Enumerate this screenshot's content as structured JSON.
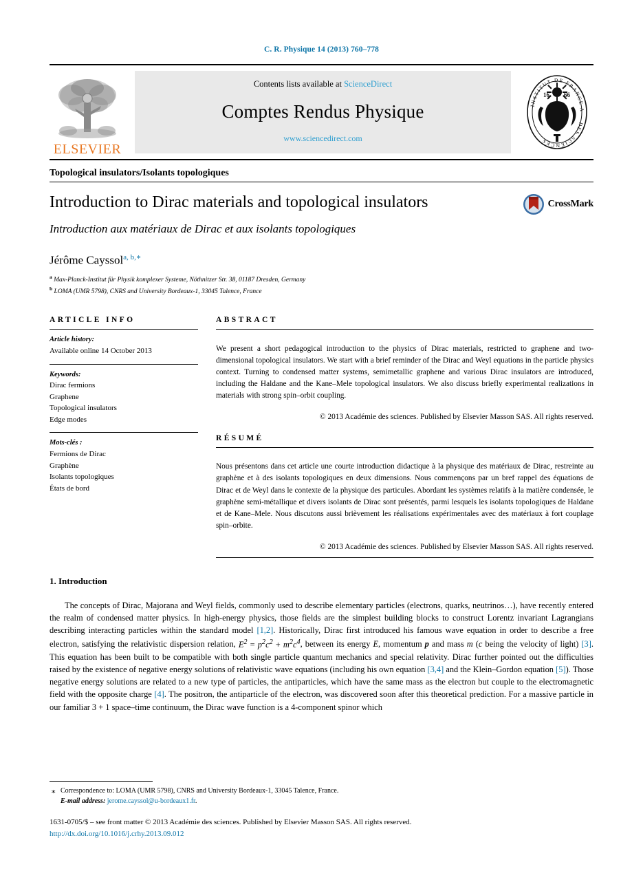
{
  "running_head": "C. R. Physique 14 (2013) 760–778",
  "masthead": {
    "contents_prefix": "Contents lists available at ",
    "contents_link": "ScienceDirect",
    "journal_title": "Comptes Rendus Physique",
    "url": "www.sciencedirect.com",
    "publisher_wordmark": "ELSEVIER",
    "seal_text": "INSTITUT DE FRANCE · ACADÉMIE DES SCIENCES 1666"
  },
  "section_label": "Topological insulators/Isolants topologiques",
  "title": {
    "main": "Introduction to Dirac materials and topological insulators",
    "french": "Introduction aux matériaux de Dirac et aux isolants topologiques",
    "crossmark_label": "CrossMark"
  },
  "authors": {
    "name": "Jérôme Cayssol",
    "marks": "a, b,",
    "star": "∗",
    "affiliations": [
      {
        "mark": "a",
        "text": "Max-Planck-Institut für Physik komplexer Systeme, Nöthnitzer Str. 38, 01187 Dresden, Germany"
      },
      {
        "mark": "b",
        "text": "LOMA (UMR 5798), CNRS and University Bordeaux-1, 33045 Talence, France"
      }
    ]
  },
  "article_info": {
    "heading": "ARTICLE INFO",
    "history_label": "Article history:",
    "history_value": "Available online 14 October 2013",
    "keywords_label": "Keywords:",
    "keywords": [
      "Dirac fermions",
      "Graphene",
      "Topological insulators",
      "Edge modes"
    ],
    "motscles_label": "Mots-clés :",
    "motscles": [
      "Fermions de Dirac",
      "Graphène",
      "Isolants topologiques",
      "États de bord"
    ]
  },
  "abstract": {
    "heading": "ABSTRACT",
    "text": "We present a short pedagogical introduction to the physics of Dirac materials, restricted to graphene and two-dimensional topological insulators. We start with a brief reminder of the Dirac and Weyl equations in the particle physics context. Turning to condensed matter systems, semimetallic graphene and various Dirac insulators are introduced, including the Haldane and the Kane–Mele topological insulators. We also discuss briefly experimental realizations in materials with strong spin–orbit coupling.",
    "copyright": "© 2013 Académie des sciences. Published by Elsevier Masson SAS. All rights reserved."
  },
  "resume": {
    "heading": "RÉSUMÉ",
    "text": "Nous présentons dans cet article une courte introduction didactique à la physique des matériaux de Dirac, restreinte au graphène et à des isolants topologiques en deux dimensions. Nous commençons par un bref rappel des équations de Dirac et de Weyl dans le contexte de la physique des particules. Abordant les systèmes relatifs à la matière condensée, le graphène semi-métallique et divers isolants de Dirac sont présentés, parmi lesquels les isolants topologiques de Haldane et de Kane–Mele. Nous discutons aussi brièvement les réalisations expérimentales avec des matériaux à fort couplage spin–orbite.",
    "copyright": "© 2013 Académie des sciences. Published by Elsevier Masson SAS. All rights reserved."
  },
  "body": {
    "section_number_title": "1. Introduction",
    "p1_a": "The concepts of Dirac, Majorana and Weyl fields, commonly used to describe elementary particles (electrons, quarks, neutrinos…), have recently entered the realm of condensed matter physics. In high-energy physics, those fields are the simplest building blocks to construct Lorentz invariant Lagrangians describing interacting particles within the standard model ",
    "ref_12": "[1,2]",
    "p1_b": ". Historically, Dirac first introduced his famous wave equation in order to describe a free electron, satisfying the relativistic dispersion relation, ",
    "equation": "E² = p²c² + m²c⁴",
    "p1_c": ", between its energy ",
    "sym_E": "E",
    "p1_d": ", momentum ",
    "sym_p": "p",
    "p1_e": " and mass ",
    "sym_m": "m",
    "p1_f": " (",
    "sym_c": "c",
    "p1_g": " being the velocity of light) ",
    "ref_3": "[3]",
    "p1_h": ". This equation has been built to be compatible with both single particle quantum mechanics and special relativity. Dirac further pointed out the difficulties raised by the existence of negative energy solutions of relativistic wave equations (including his own equation ",
    "ref_34": "[3,4]",
    "p1_i": " and the Klein–Gordon equation ",
    "ref_5": "[5]",
    "p1_j": "). Those negative energy solutions are related to a new type of particles, the antiparticles, which have the same mass as the electron but couple to the electromagnetic field with the opposite charge ",
    "ref_4": "[4]",
    "p1_k": ". The positron, the antiparticle of the electron, was discovered soon after this theoretical prediction. For a massive particle in our familiar 3 + 1 space–time continuum, the Dirac wave function is a 4-component spinor which"
  },
  "footer": {
    "star": "∗",
    "correspondence": "Correspondence to: LOMA (UMR 5798), CNRS and University Bordeaux-1, 33045 Talence, France.",
    "email_label": "E-mail address:",
    "email": "jerome.cayssol@u-bordeaux1.fr",
    "email_trailing": ".",
    "issn": "1631-0705/$ – see front matter © 2013 Académie des sciences. Published by Elsevier Masson SAS. All rights reserved.",
    "doi": "http://dx.doi.org/10.1016/j.crhy.2013.09.012"
  },
  "colors": {
    "link": "#0f76a8",
    "sciencedirect": "#2f9fd0",
    "elsevier_orange": "#e87722"
  }
}
